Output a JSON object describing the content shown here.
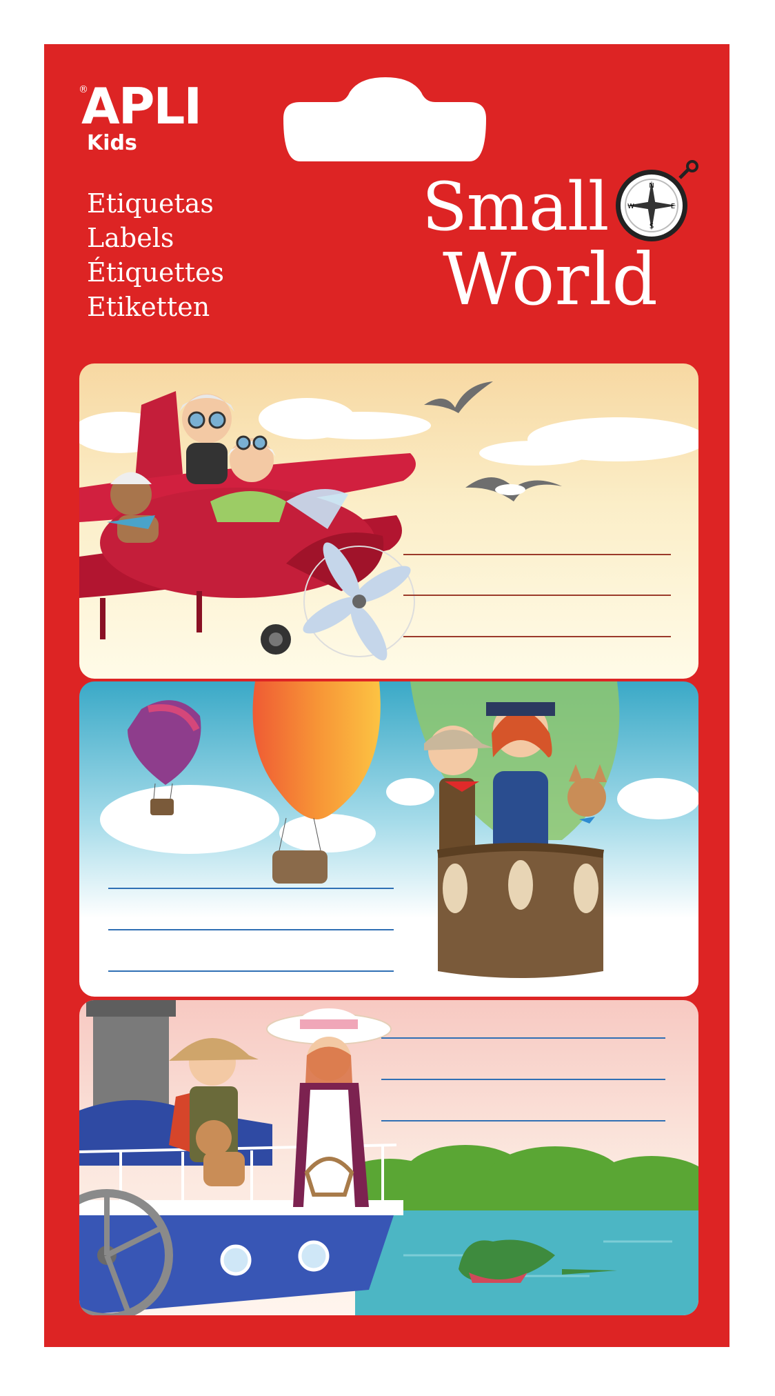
{
  "brand": {
    "name": "APLI",
    "registered_mark": "®",
    "sub": "Kids"
  },
  "languages": [
    "Etiquetas",
    "Labels",
    "Étiquettes",
    "Etiketten"
  ],
  "collection": {
    "line1": "Small",
    "line2": "World"
  },
  "compass_letters": {
    "n": "N",
    "e": "E",
    "s": "S",
    "w": "W"
  },
  "colors": {
    "card_red": "#dd2424",
    "label1_line": "#9b3a2a",
    "label2_line": "#2f6fb4",
    "label3_line": "#2f6fb4"
  },
  "labels": [
    {
      "theme": "airplane-icon",
      "write_lines": 3
    },
    {
      "theme": "hot-air-balloon-icon",
      "write_lines": 3
    },
    {
      "theme": "steamboat-icon",
      "write_lines": 3
    }
  ]
}
